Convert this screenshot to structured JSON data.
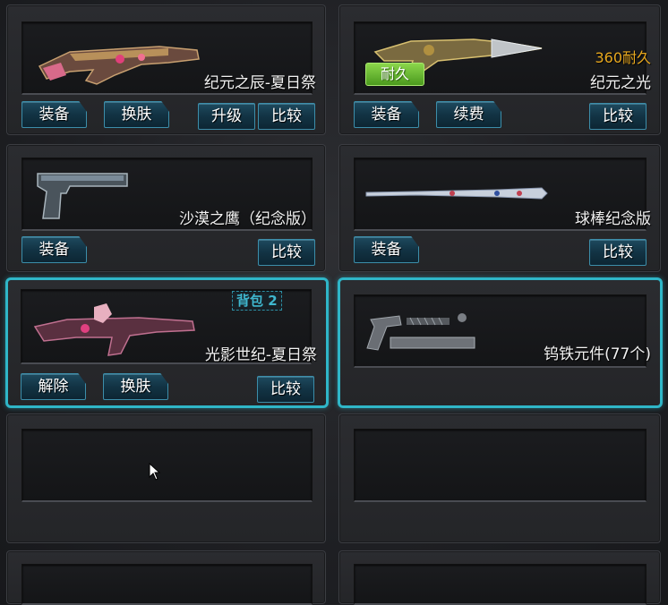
{
  "items": [
    {
      "name": "纪元之辰-夏日祭",
      "buttons": [
        "装备",
        "换肤",
        "升级",
        "比较"
      ]
    },
    {
      "name": "纪元之光",
      "durability": "360耐久",
      "tag": "耐久",
      "buttons": [
        "装备",
        "续费",
        "比较"
      ]
    },
    {
      "name": "沙漠之鹰（纪念版）",
      "buttons": [
        "装备",
        "比较"
      ]
    },
    {
      "name": "球棒纪念版",
      "buttons": [
        "装备",
        "比较"
      ]
    },
    {
      "name": "光影世纪-夏日祭",
      "bag": "背包 2",
      "buttons": [
        "解除",
        "换肤",
        "比较"
      ]
    },
    {
      "name": "钨铁元件(77个)"
    }
  ],
  "colors": {
    "selected_border": "#2fb6c8",
    "durability": "#e8a81e",
    "durable_tag": "#6bbf33"
  }
}
